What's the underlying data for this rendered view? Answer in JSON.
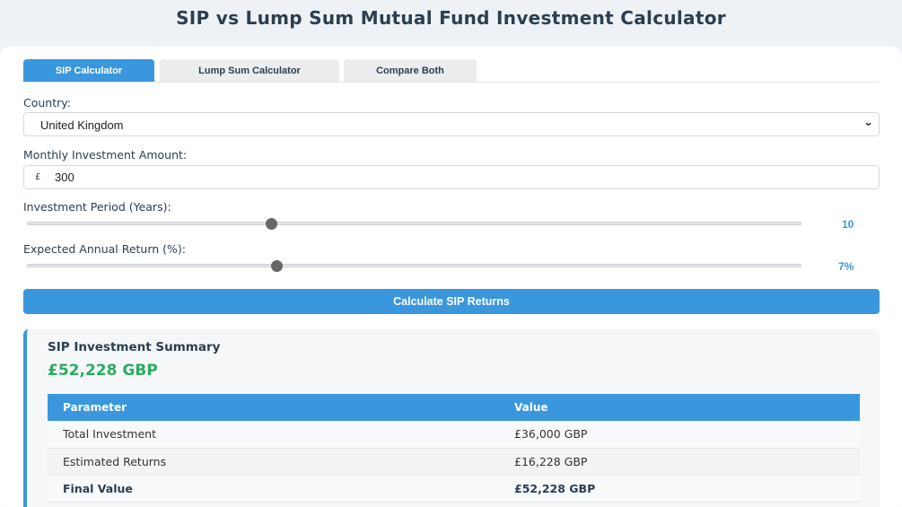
{
  "page": {
    "title": "SIP vs Lump Sum Mutual Fund Investment Calculator"
  },
  "tabs": [
    {
      "label": "SIP Calculator",
      "active": true
    },
    {
      "label": "Lump Sum Calculator",
      "active": false
    },
    {
      "label": "Compare Both",
      "active": false
    }
  ],
  "form": {
    "country_label": "Country:",
    "country_value": "United Kingdom",
    "monthly_label": "Monthly Investment Amount:",
    "currency_symbol": "£",
    "monthly_value": "300",
    "period_label": "Investment Period (Years):",
    "period_value": "10",
    "period_fraction": 0.315,
    "return_label": "Expected Annual Return (%):",
    "return_value": "7%",
    "return_fraction": 0.322,
    "calculate_label": "Calculate SIP Returns"
  },
  "summary": {
    "title": "SIP Investment Summary",
    "final_amount": "£52,228 GBP",
    "table": {
      "headers": [
        "Parameter",
        "Value"
      ],
      "rows": [
        [
          "Total Investment",
          "£36,000 GBP"
        ],
        [
          "Estimated Returns",
          "£16,228 GBP"
        ],
        [
          "Final Value",
          "£52,228 GBP"
        ]
      ]
    }
  },
  "colors": {
    "accent": "#3a97dd",
    "positive": "#27ae60",
    "text": "#2c3e50"
  }
}
